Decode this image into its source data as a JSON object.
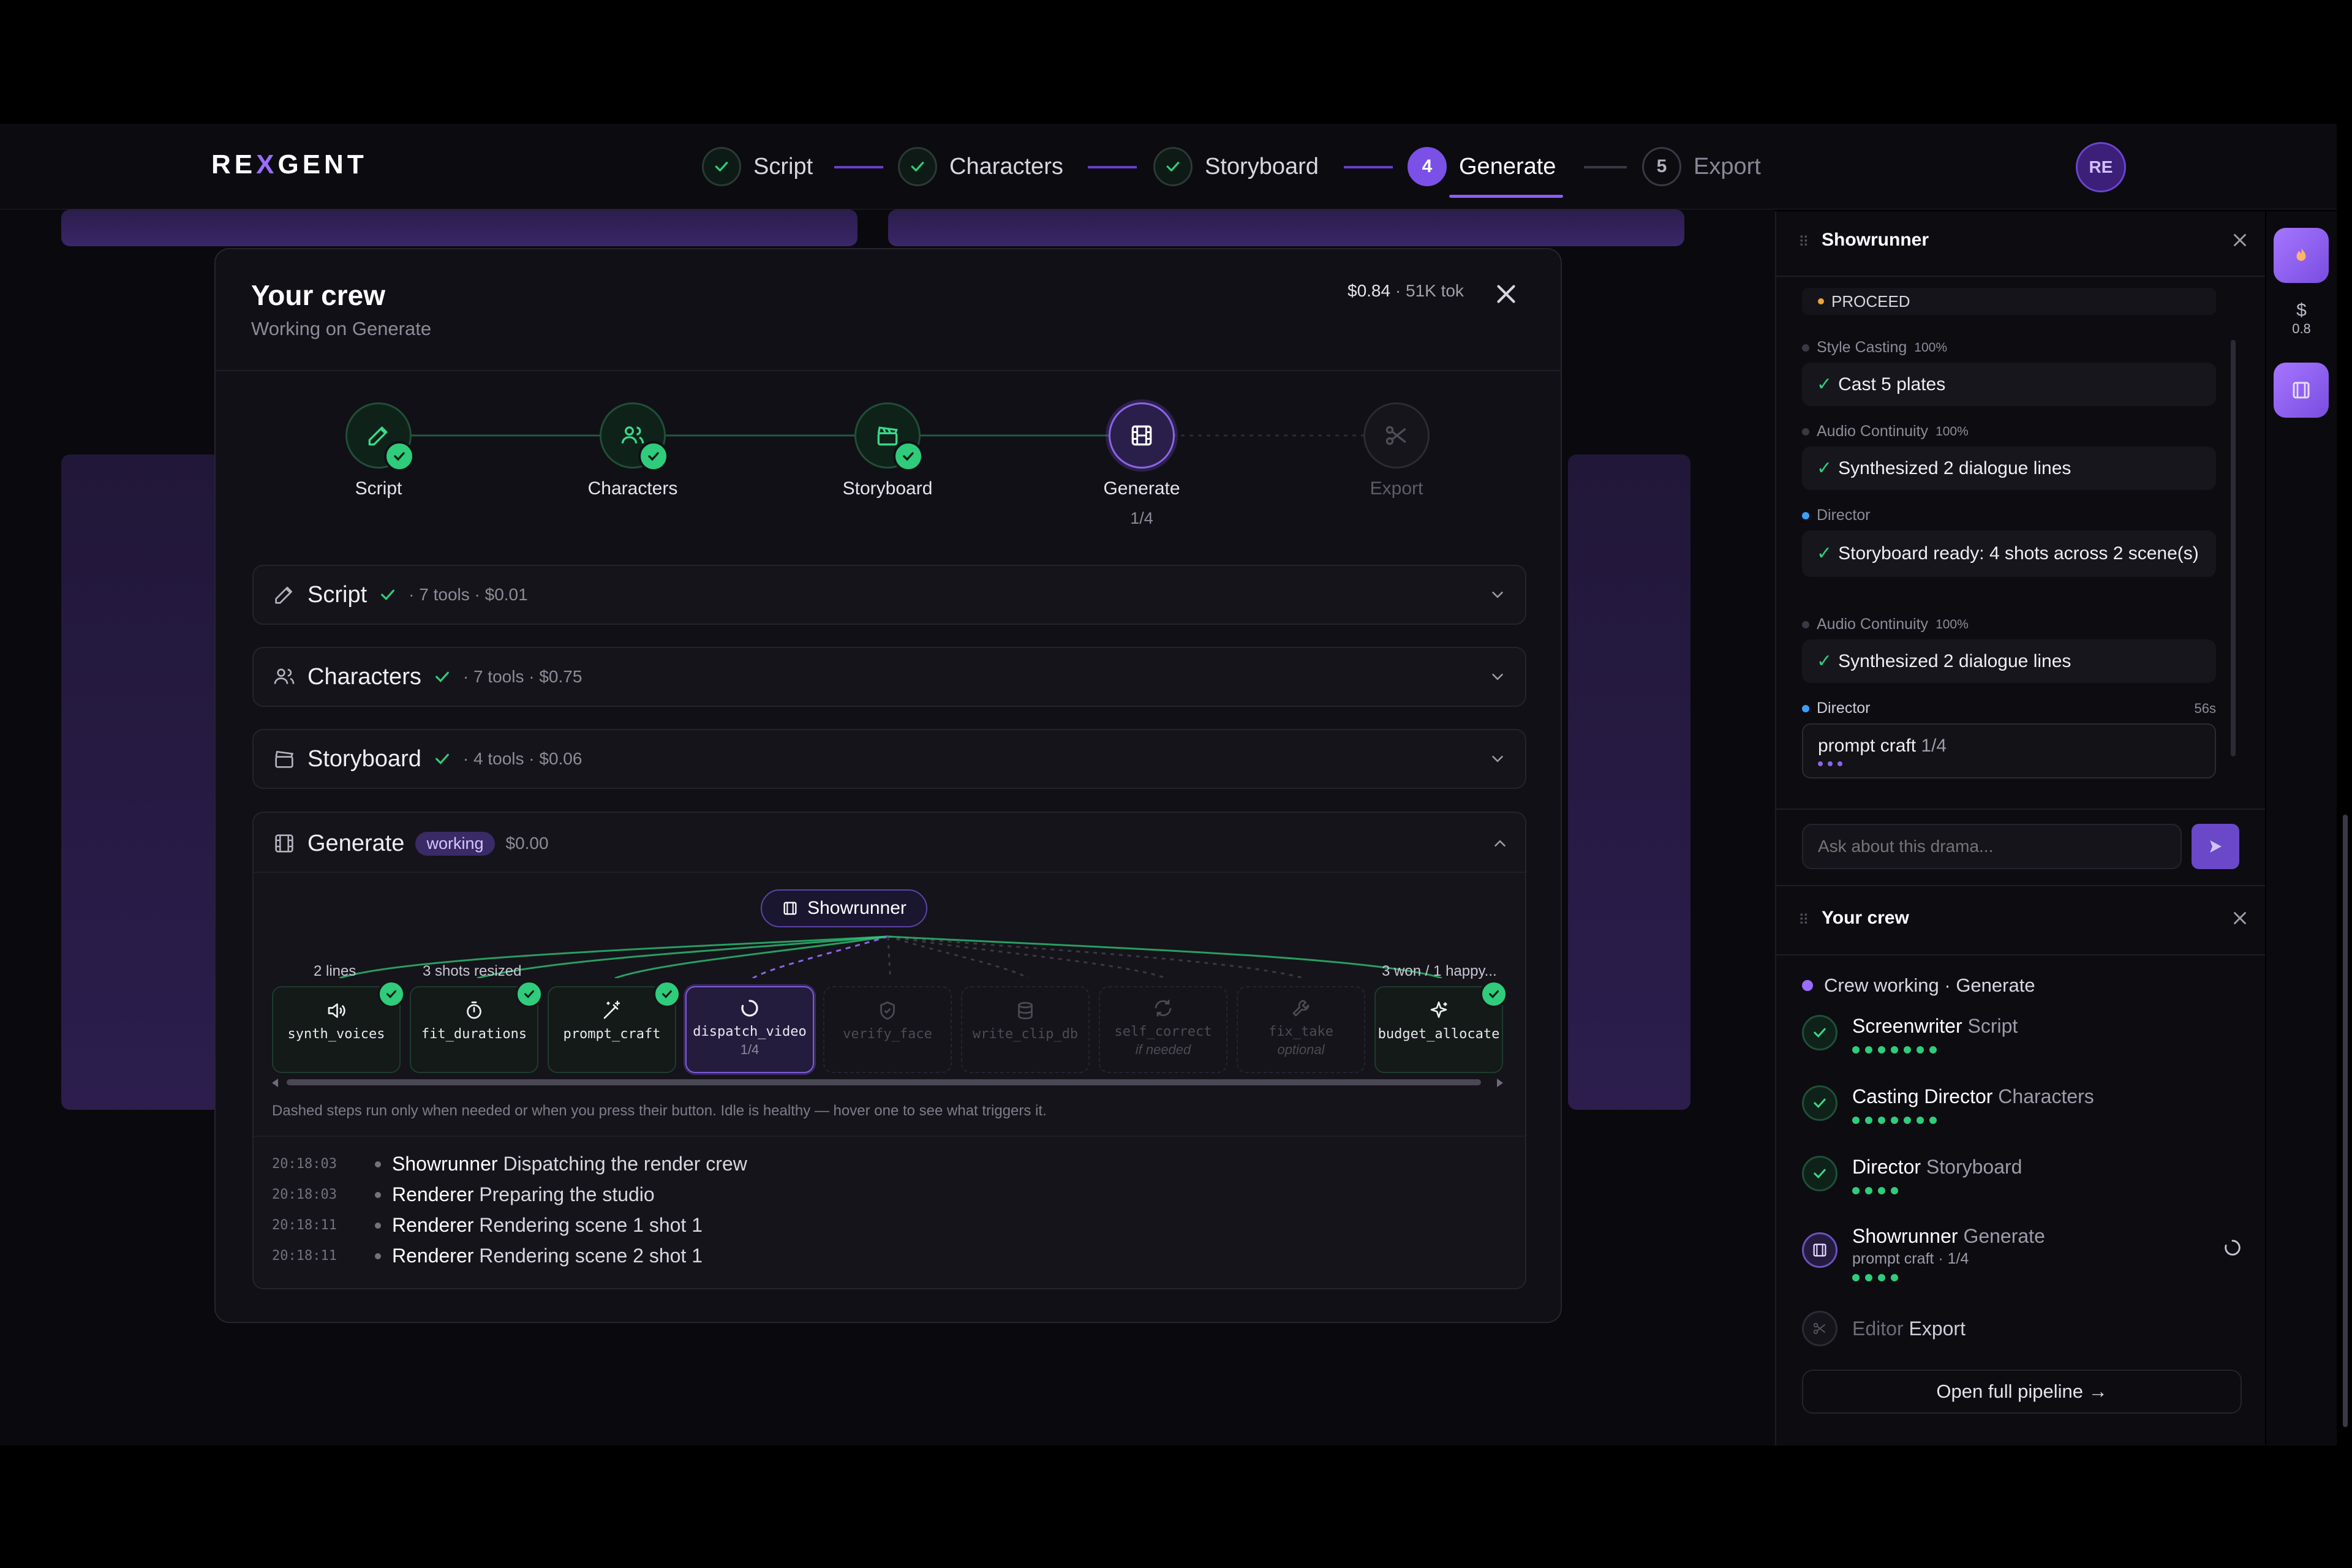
{
  "brand": {
    "name_a": "RE",
    "name_x": "X",
    "name_b": "GENT"
  },
  "nav_steps": [
    {
      "label": "Script",
      "state": "done"
    },
    {
      "label": "Characters",
      "state": "done"
    },
    {
      "label": "Storyboard",
      "state": "done"
    },
    {
      "label": "Generate",
      "state": "active",
      "number": "4"
    },
    {
      "label": "Export",
      "state": "todo",
      "number": "5"
    }
  ],
  "user": {
    "initials": "RE"
  },
  "modal": {
    "title": "Your crew",
    "subtitle": "Working on Generate",
    "cost": "$0.84",
    "tokens": "· 51K tok",
    "pipeline": [
      {
        "label": "Script",
        "icon": "pencil-icon",
        "state": "done"
      },
      {
        "label": "Characters",
        "icon": "users-icon",
        "state": "done"
      },
      {
        "label": "Storyboard",
        "icon": "clapperboard-icon",
        "state": "done"
      },
      {
        "label": "Generate",
        "icon": "film-icon",
        "state": "current",
        "progress": "1/4"
      },
      {
        "label": "Export",
        "icon": "scissors-icon",
        "state": "todo"
      }
    ],
    "sections": [
      {
        "title": "Script",
        "meta": "· 7 tools · $0.01",
        "icon": "pencil-icon"
      },
      {
        "title": "Characters",
        "meta": "· 7 tools · $0.75",
        "icon": "users-icon"
      },
      {
        "title": "Storyboard",
        "meta": "· 4 tools · $0.06",
        "icon": "clapperboard-icon"
      }
    ],
    "generate": {
      "title": "Generate",
      "badge": "working",
      "cost": "$0.00",
      "root": "Showrunner",
      "tool_notes": {
        "synth": "2 lines",
        "fit": "3 shots resized",
        "budget": "3 won / 1 happy..."
      },
      "tools": [
        {
          "name": "synth_voices",
          "icon": "speaker-icon",
          "state": "done",
          "sub": ""
        },
        {
          "name": "fit_durations",
          "icon": "timer-icon",
          "state": "done",
          "sub": ""
        },
        {
          "name": "prompt_craft",
          "icon": "wand-icon",
          "state": "done",
          "sub": ""
        },
        {
          "name": "dispatch_video",
          "icon": "spinner-icon",
          "state": "active",
          "sub": "1/4"
        },
        {
          "name": "verify_face",
          "icon": "shield-icon",
          "state": "idle",
          "sub": ""
        },
        {
          "name": "write_clip_db",
          "icon": "database-icon",
          "state": "idle",
          "sub": ""
        },
        {
          "name": "self_correct",
          "icon": "refresh-icon",
          "state": "idle",
          "sub": "if needed"
        },
        {
          "name": "fix_take",
          "icon": "wrench-icon",
          "state": "idle",
          "sub": "optional"
        },
        {
          "name": "budget_allocate",
          "icon": "sparkle-icon",
          "state": "done",
          "sub": ""
        }
      ],
      "hint": "Dashed steps run only when needed or when you press their button. Idle is healthy — hover one to see what triggers it.",
      "logs": [
        {
          "time": "20:18:03",
          "actor": "Showrunner",
          "text": "Dispatching the render crew"
        },
        {
          "time": "20:18:03",
          "actor": "Renderer",
          "text": "Preparing the studio"
        },
        {
          "time": "20:18:11",
          "actor": "Renderer",
          "text": "Rendering scene 1 shot 1"
        },
        {
          "time": "20:18:11",
          "actor": "Renderer",
          "text": "Rendering scene 2 shot 1"
        }
      ]
    }
  },
  "showrunner_panel": {
    "title": "Showrunner",
    "proceed": "PROCEED",
    "messages": [
      {
        "actor": "Style Casting",
        "pct": "100%",
        "text": "Cast 5 plates"
      },
      {
        "actor": "Audio Continuity",
        "pct": "100%",
        "text": "Synthesized 2 dialogue lines"
      },
      {
        "actor": "Director",
        "pct": "",
        "text": "Storyboard ready: 4 shots across 2 scene(s)"
      },
      {
        "actor": "Audio Continuity",
        "pct": "100%",
        "text": "Synthesized 2 dialogue lines"
      }
    ],
    "live": {
      "actor": "Director",
      "time": "56s",
      "text": "prompt craft",
      "progress": "1/4"
    },
    "input_placeholder": "Ask about this drama..."
  },
  "crew_panel": {
    "title": "Your crew",
    "status": "Crew working · Generate",
    "members": [
      {
        "name": "Screenwriter",
        "stage": "Script",
        "dots": 7,
        "state": "done",
        "detail": ""
      },
      {
        "name": "Casting Director",
        "stage": "Characters",
        "dots": 7,
        "state": "done",
        "detail": ""
      },
      {
        "name": "Director",
        "stage": "Storyboard",
        "dots": 4,
        "state": "done",
        "detail": ""
      },
      {
        "name": "Showrunner",
        "stage": "Generate",
        "dots": 4,
        "state": "active",
        "detail": "prompt craft · 1/4"
      },
      {
        "name": "Editor",
        "stage": "Export",
        "dots": 0,
        "state": "todo",
        "detail": ""
      }
    ],
    "open_label": "Open full pipeline →"
  },
  "sidebar": {
    "cost_symbol": "$",
    "cost_value": "0.8"
  },
  "colors": {
    "accent": "#7b50e6",
    "success": "#2fcc7b",
    "bg": "#0c0b10"
  }
}
